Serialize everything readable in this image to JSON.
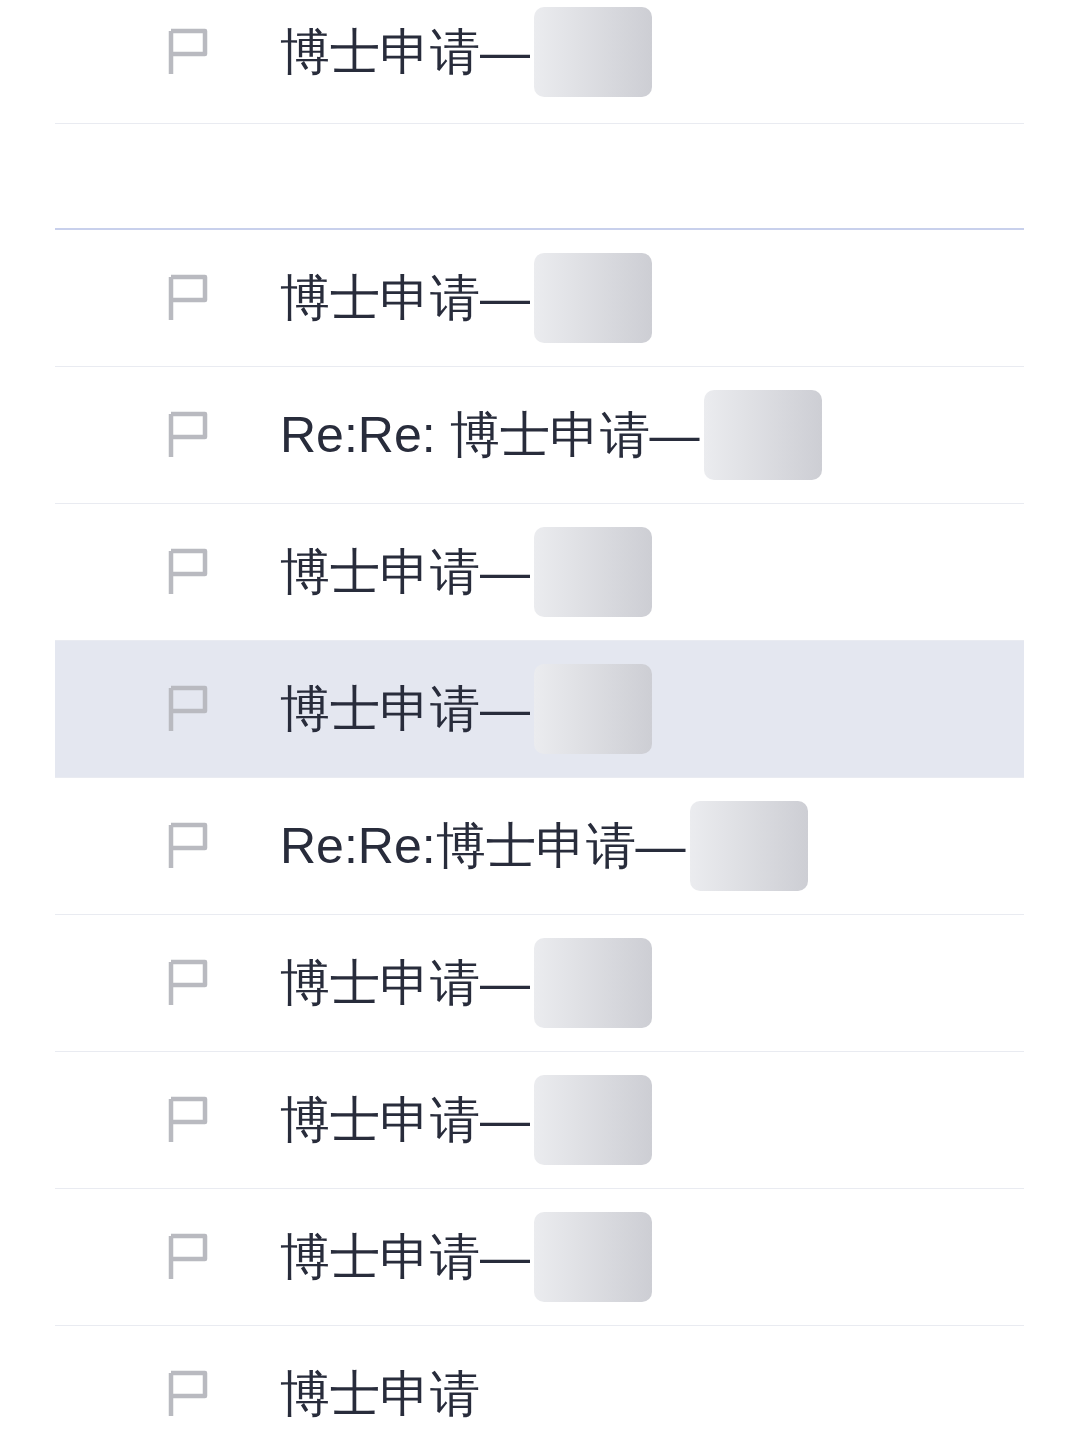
{
  "groups": [
    {
      "rows": [
        {
          "subject": "博士申请—",
          "flagged": false,
          "selected": false,
          "redacted": true
        }
      ]
    },
    {
      "rows": [
        {
          "subject": "博士申请—",
          "flagged": false,
          "selected": false,
          "redacted": true
        },
        {
          "subject": "Re:Re: 博士申请—",
          "flagged": false,
          "selected": false,
          "redacted": true
        },
        {
          "subject": "博士申请—",
          "flagged": false,
          "selected": false,
          "redacted": true
        },
        {
          "subject": "博士申请—",
          "flagged": false,
          "selected": true,
          "redacted": true
        },
        {
          "subject": "Re:Re:博士申请—",
          "flagged": false,
          "selected": false,
          "redacted": true
        },
        {
          "subject": "博士申请—",
          "flagged": false,
          "selected": false,
          "redacted": true
        },
        {
          "subject": "博士申请—",
          "flagged": false,
          "selected": false,
          "redacted": true
        },
        {
          "subject": "博士申请—",
          "flagged": false,
          "selected": false,
          "redacted": true
        },
        {
          "subject": "博士申请",
          "flagged": false,
          "selected": false,
          "redacted": false
        }
      ]
    }
  ]
}
